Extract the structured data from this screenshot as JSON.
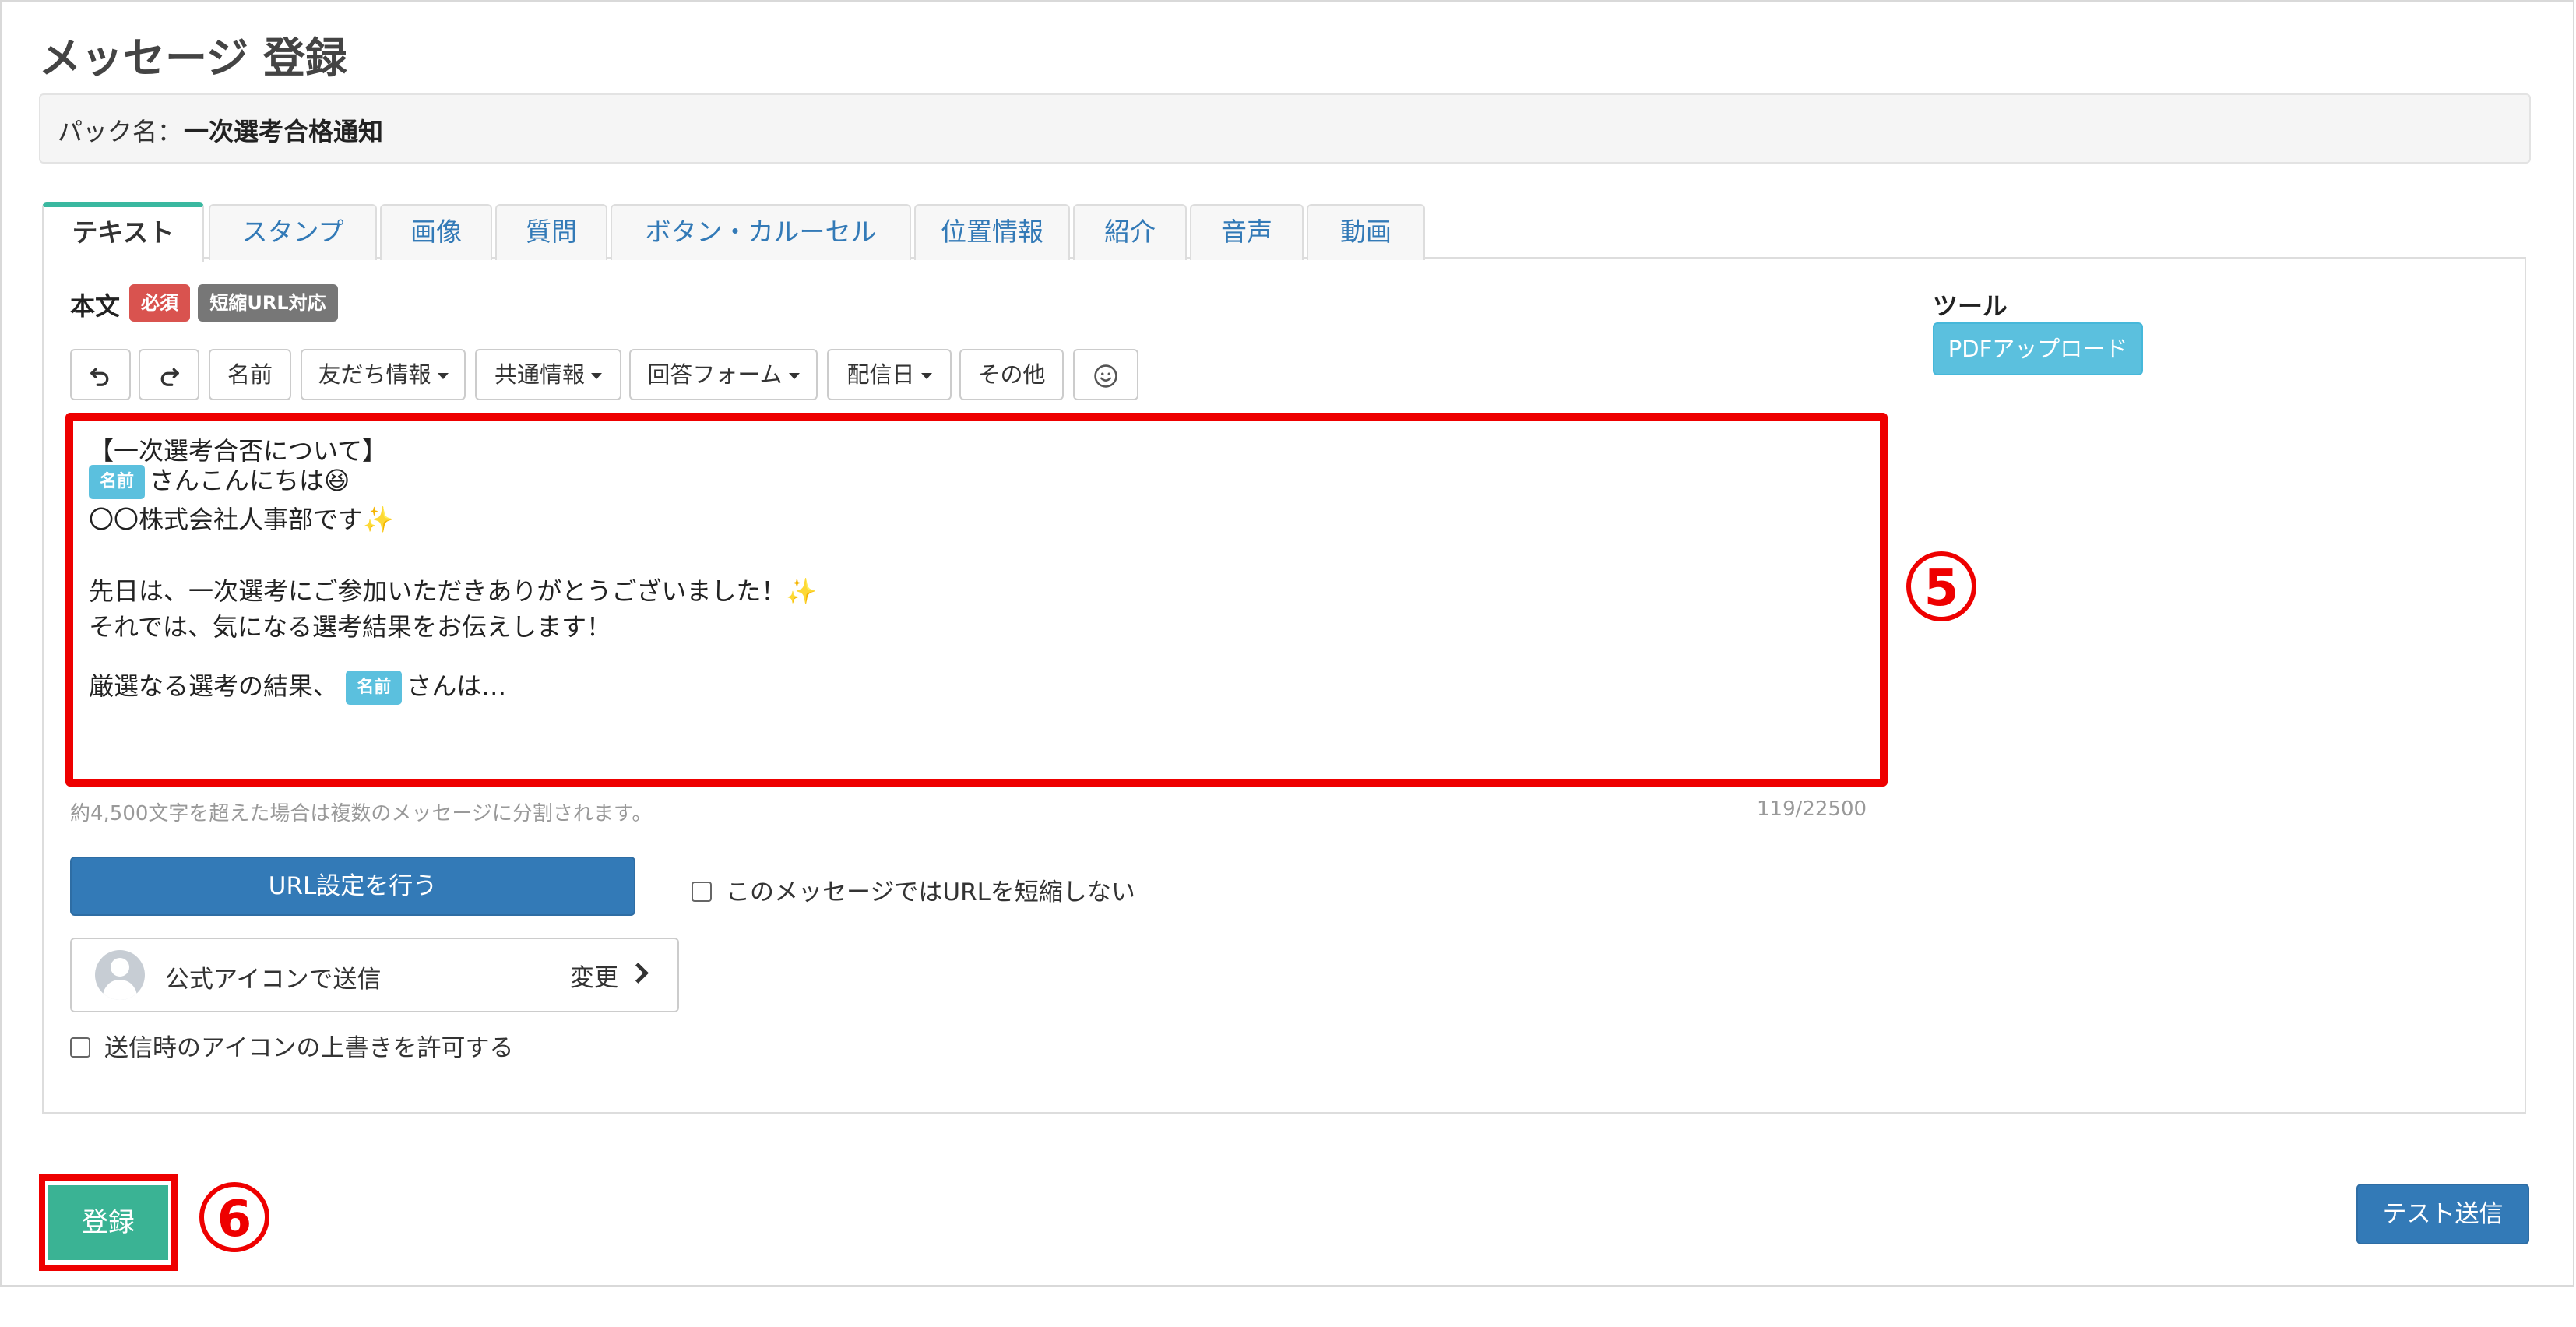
{
  "page": {
    "title": "メッセージ 登録"
  },
  "pack": {
    "label": "パック名：",
    "name": "一次選考合格通知"
  },
  "tabs": [
    {
      "label": "テキスト",
      "active": true
    },
    {
      "label": "スタンプ"
    },
    {
      "label": "画像"
    },
    {
      "label": "質問"
    },
    {
      "label": "ボタン・カルーセル"
    },
    {
      "label": "位置情報"
    },
    {
      "label": "紹介"
    },
    {
      "label": "音声"
    },
    {
      "label": "動画"
    }
  ],
  "body_section": {
    "label": "本文",
    "required_badge": "必須",
    "short_url_badge": "短縮URL対応"
  },
  "toolbar": {
    "undo_icon": "undo-icon",
    "redo_icon": "redo-icon",
    "name": "名前",
    "friend_info": "友だち情報",
    "shared_info": "共通情報",
    "answer_form": "回答フォーム",
    "delivery_date": "配信日",
    "other": "その他",
    "emoji_icon": "smiley-icon"
  },
  "editor": {
    "line1": "【一次選考合否について】",
    "name_tag": "名前",
    "line2_after": "さんこんにちは😆",
    "line3": "〇〇株式会社人事部です",
    "line4": "先日は、一次選考にご参加いただきありがとうございました！",
    "line5": "それでは、気になる選考結果をお伝えします！",
    "line6_before": "厳選なる選考の結果、",
    "line6_after": "さんは…",
    "sparkle": "✨"
  },
  "hint": "約4,500文字を超えた場合は複数のメッセージに分割されます。",
  "counter": "119/22500",
  "annotations": {
    "five": "5",
    "six": "6"
  },
  "tools": {
    "title": "ツール",
    "pdf_upload": "PDFアップロード"
  },
  "url_button": "URL設定を行う",
  "no_shorten_label": "このメッセージではURLを短縮しない",
  "icon_send": {
    "label": "公式アイコンで送信",
    "change": "変更"
  },
  "allow_icon_override": "送信時のアイコンの上書きを許可する",
  "actions": {
    "submit": "登録",
    "test_send": "テスト送信"
  },
  "colors": {
    "highlight": "#ee0000",
    "primary": "#337ab7",
    "info": "#5bc0de",
    "success": "#3ab394",
    "danger": "#d9534f"
  }
}
